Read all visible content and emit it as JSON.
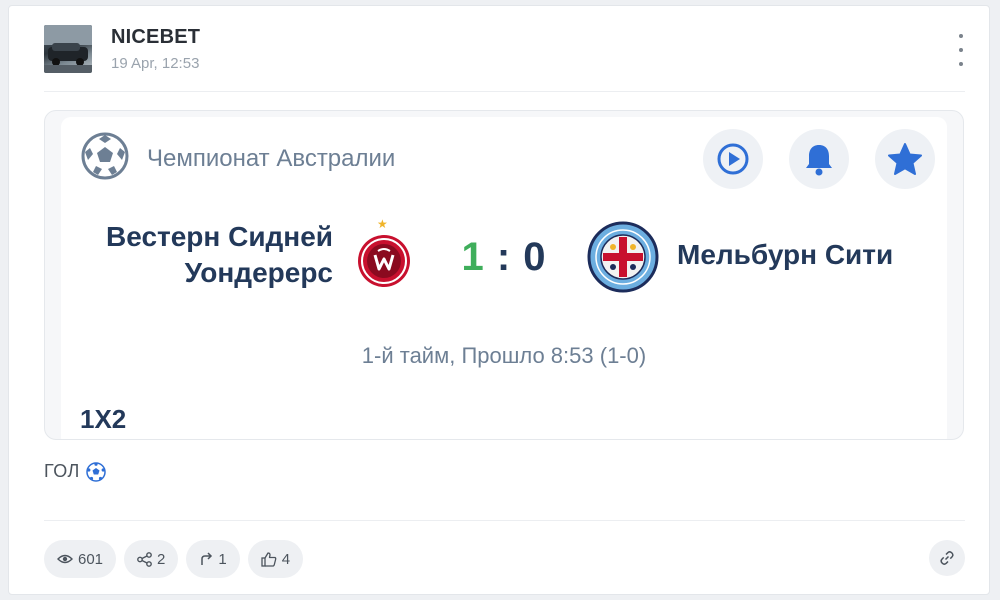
{
  "post": {
    "author": "NICEBET",
    "time": "19 Apr, 12:53",
    "text": "ГОЛ",
    "text_emoji_icon": "soccer-ball-icon"
  },
  "match": {
    "league": "Чемпионат Австралии",
    "league_icon": "soccer-ball-icon",
    "home_team": "Вестерн Сидней Уондерерс",
    "away_team": "Мельбурн Сити",
    "home_score": "1",
    "score_separator": ":",
    "away_score": "0",
    "status": "1-й тайм, Прошло 8:53 (1-0)",
    "market": "1X2",
    "buttons": [
      "play-icon",
      "bell-icon",
      "star-icon"
    ]
  },
  "stats": {
    "views": "601",
    "shares": "2",
    "reposts": "1",
    "likes": "4"
  },
  "colors": {
    "accent": "#2f6fd6",
    "score_home": "#3fae5b",
    "team_text": "#23395a",
    "muted": "#6d7f94"
  }
}
